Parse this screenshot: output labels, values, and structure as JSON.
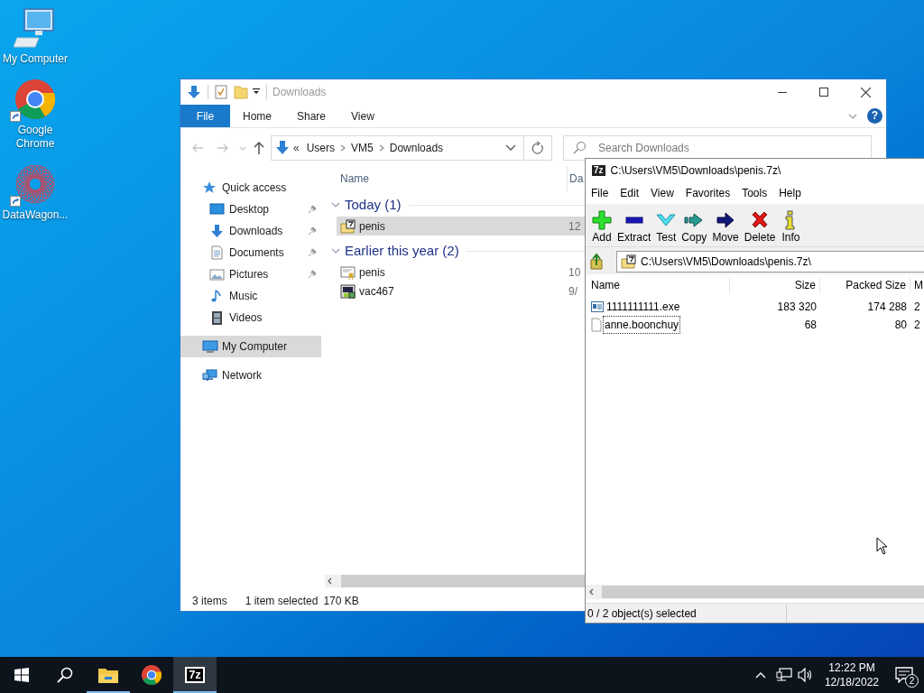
{
  "desktop": {
    "icons": [
      {
        "label": "My Computer",
        "kind": "computer",
        "shortcut": false
      },
      {
        "label": "Google Chrome",
        "kind": "chrome",
        "shortcut": true
      },
      {
        "label": "DataWagon...",
        "kind": "datawagon",
        "shortcut": true
      }
    ]
  },
  "explorer": {
    "title": "Downloads",
    "ribbon_tabs": [
      {
        "label": "File",
        "kind": "file"
      },
      {
        "label": "Home",
        "kind": "tab"
      },
      {
        "label": "Share",
        "kind": "tab"
      },
      {
        "label": "View",
        "kind": "tab"
      }
    ],
    "address": {
      "overflow": "«",
      "path": [
        "Users",
        "VM5",
        "Downloads"
      ]
    },
    "search": {
      "placeholder": "Search Downloads"
    },
    "help": "?",
    "navigation": [
      {
        "label": "Quick access",
        "kind": "star",
        "selected": false,
        "children": [
          {
            "label": "Desktop",
            "kind": "desktop",
            "pinned": true,
            "selected": false
          },
          {
            "label": "Downloads",
            "kind": "download",
            "pinned": true,
            "selected": false
          },
          {
            "label": "Documents",
            "kind": "document",
            "pinned": true,
            "selected": false
          },
          {
            "label": "Pictures",
            "kind": "pictures",
            "pinned": true,
            "selected": false
          },
          {
            "label": "Music",
            "kind": "music",
            "pinned": false,
            "selected": false
          },
          {
            "label": "Videos",
            "kind": "videos",
            "pinned": false,
            "selected": false
          }
        ]
      },
      {
        "label": "My Computer",
        "kind": "computer",
        "selected": true
      },
      {
        "label": "Network",
        "kind": "network",
        "selected": false
      }
    ],
    "columns": [
      "Name",
      "Da"
    ],
    "groups": [
      {
        "title": "Today (1)",
        "expanded": true,
        "files": [
          {
            "name": "penis",
            "column_2": "12",
            "kind": "archive",
            "selected": true
          }
        ]
      },
      {
        "title": "Earlier this year (2)",
        "expanded": true,
        "files": [
          {
            "name": "penis",
            "column_2": "10",
            "kind": "certificate",
            "selected": false
          },
          {
            "name": "vac467",
            "column_2": "9/",
            "kind": "program",
            "selected": false
          }
        ]
      }
    ],
    "status_bar": [
      "3 items",
      "1 item selected",
      "170 KB"
    ]
  },
  "sevenzip": {
    "title": "C:\\Users\\VM5\\Downloads\\penis.7z\\",
    "logo": "7z",
    "menu": [
      "File",
      "Edit",
      "View",
      "Favorites",
      "Tools",
      "Help"
    ],
    "toolbar": [
      {
        "label": "Add",
        "kind": "add"
      },
      {
        "label": "Extract",
        "kind": "extract"
      },
      {
        "label": "Test",
        "kind": "test"
      },
      {
        "label": "Copy",
        "kind": "copy"
      },
      {
        "label": "Move",
        "kind": "move"
      },
      {
        "label": "Delete",
        "kind": "delete"
      },
      {
        "label": "Info",
        "kind": "info"
      }
    ],
    "address": "C:\\Users\\VM5\\Downloads\\penis.7z\\",
    "columns": [
      "Name",
      "Size",
      "Packed Size",
      "M"
    ],
    "rows": [
      {
        "name": "1111111111.exe",
        "size": "183 320",
        "packed_size": "174 288",
        "column_4": "2",
        "kind": "exe",
        "focused": false
      },
      {
        "name": "anne.boonchuy",
        "size": "68",
        "packed_size": "80",
        "column_4": "2",
        "kind": "file",
        "focused": true
      }
    ],
    "status_bar": "0 / 2 object(s) selected"
  },
  "taskbar": {
    "apps": [
      {
        "kind": "explorer",
        "running": true,
        "active": false
      },
      {
        "kind": "chrome",
        "running": false,
        "active": false
      },
      {
        "kind": "sevenzip",
        "label": "7z",
        "running": true,
        "active": true
      }
    ],
    "time": "12:22 PM",
    "date": "12/18/2022",
    "notifications": "2"
  }
}
